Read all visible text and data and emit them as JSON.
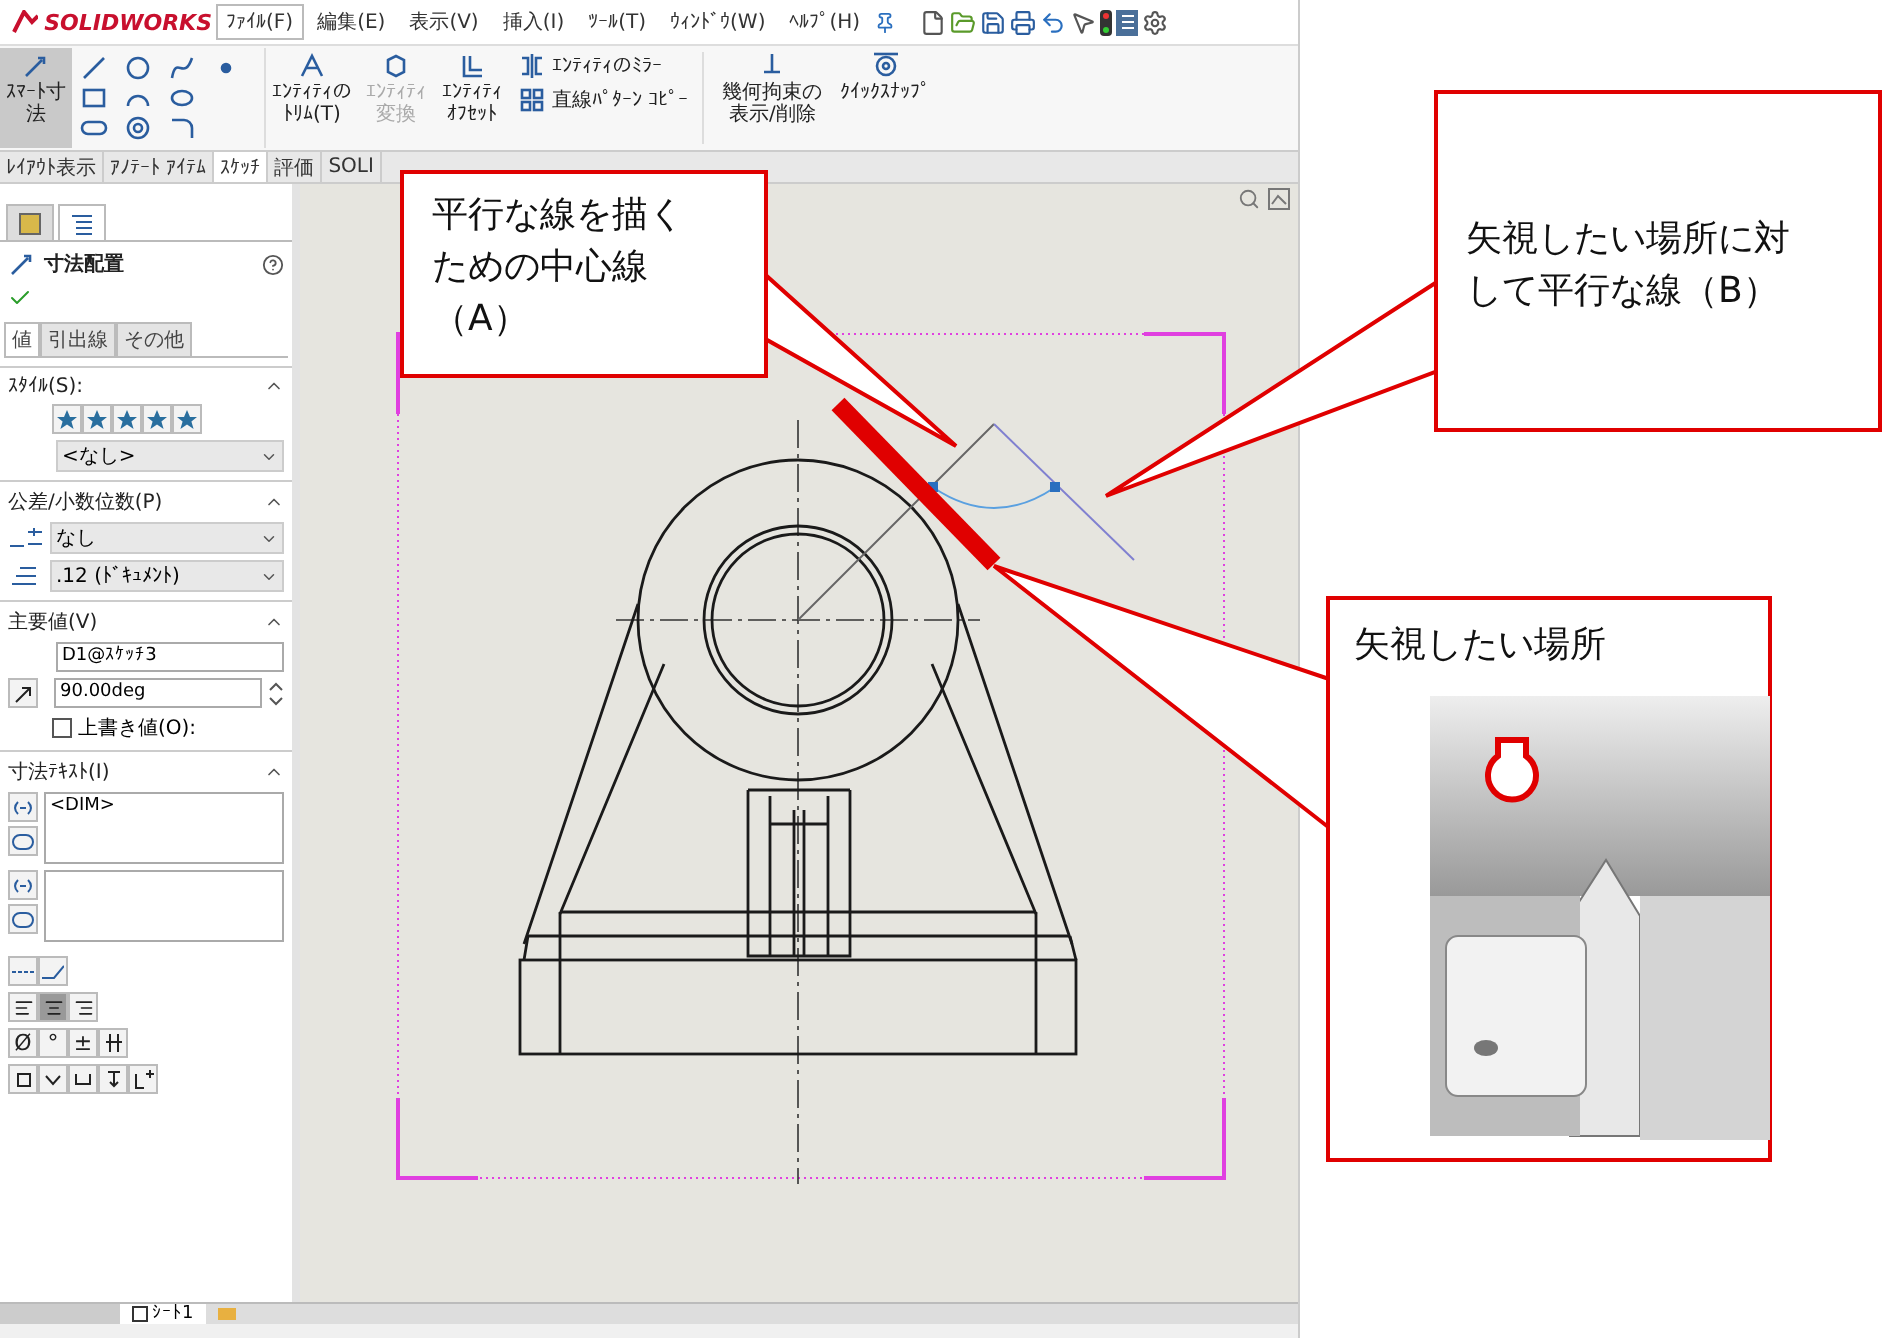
{
  "app": {
    "logo": "SOLIDWORKS",
    "menu": [
      {
        "label": "ﾌｧｲﾙ(F)",
        "selected": true
      },
      {
        "label": "編集(E)",
        "selected": false
      },
      {
        "label": "表示(V)",
        "selected": false
      },
      {
        "label": "挿入(I)",
        "selected": false
      },
      {
        "label": "ﾂｰﾙ(T)",
        "selected": false
      },
      {
        "label": "ｳｨﾝﾄﾞｳ(W)",
        "selected": false
      },
      {
        "label": "ﾍﾙﾌﾟ(H)",
        "selected": false
      }
    ],
    "smart_dimension": {
      "label": "ｽﾏｰﾄ寸法",
      "selected": true
    },
    "ribbon_tools": [
      {
        "kind": "trim",
        "label": "ｴﾝﾃｨﾃｨのﾄﾘﾑ(T)",
        "disabled": false
      },
      {
        "kind": "convert",
        "label": "ｴﾝﾃｨﾃｨ変換",
        "disabled": true
      },
      {
        "kind": "offset",
        "label": "ｴﾝﾃｨﾃｨｵﾌｾｯﾄ",
        "disabled": false
      }
    ],
    "ribbon_small_tools": [
      {
        "kind": "mirror",
        "label": "ｴﾝﾃｨﾃｨのﾐﾗｰ"
      },
      {
        "kind": "pattern",
        "label": "直線ﾊﾟﾀｰﾝ ｺﾋﾟｰ"
      }
    ],
    "ribbon_tools_2": [
      {
        "kind": "relations",
        "label": "幾何拘束の表示/削除"
      },
      {
        "kind": "snap",
        "label": "ｸｲｯｸｽﾅｯﾌﾟ"
      }
    ],
    "command_tabs": [
      {
        "label": "ﾚｲｱｳﾄ表示",
        "selected": false
      },
      {
        "label": "ｱﾉﾃｰﾄ ｱｲﾃﾑ",
        "selected": false
      },
      {
        "label": "ｽｹｯﾁ",
        "selected": true
      },
      {
        "label": "評価",
        "selected": false
      },
      {
        "label": "SOLI",
        "selected": false
      }
    ]
  },
  "panel": {
    "tabs": [
      {
        "kind": "manager",
        "selected": false
      },
      {
        "kind": "properties",
        "selected": true
      }
    ],
    "title": "寸法配置",
    "subtabs": [
      {
        "label": "値",
        "selected": true
      },
      {
        "label": "引出線",
        "selected": false
      },
      {
        "label": "その他",
        "selected": false
      }
    ],
    "style": {
      "title": "ｽﾀｲﾙ(S):",
      "dropdown": "<なし>"
    },
    "tolerance": {
      "title": "公差/小数位数(P)",
      "tolerance_dropdown": "なし",
      "precision_dropdown": ".12 (ﾄﾞｷｭﾒﾝﾄ)"
    },
    "primary_value": {
      "title": "主要値(V)",
      "name_field": "D1@ｽｹｯﾁ3",
      "value_field": "90.00deg",
      "override": {
        "label": "上書き値(O):",
        "checked": false
      }
    },
    "dimension_text": {
      "title": "寸法ﾃｷｽﾄ(I)",
      "text_above": "<DIM>"
    },
    "alignment": [
      {
        "selected": false
      },
      {
        "selected": true
      },
      {
        "selected": false
      }
    ],
    "symbols": [
      "Ø",
      "°",
      "±"
    ]
  },
  "sheet_tabs": [
    {
      "label": "ｼｰﾄ1",
      "selected": true
    }
  ],
  "callouts": [
    {
      "text": "平行な線を描くための中心線（A）"
    },
    {
      "text": "矢視したい場所に対して平行な線（B）"
    },
    {
      "text": "矢視したい場所"
    }
  ]
}
